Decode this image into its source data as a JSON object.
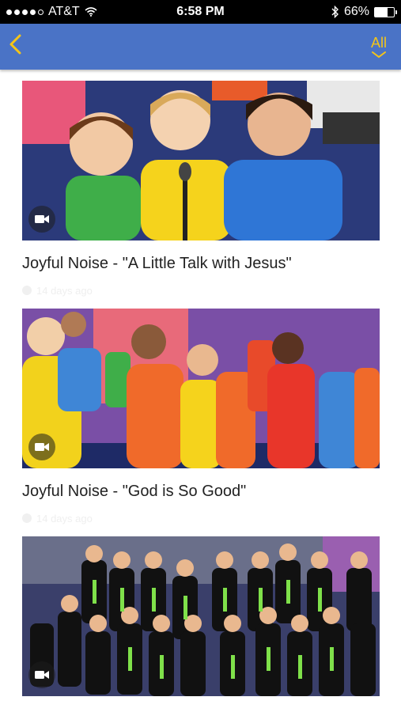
{
  "status_bar": {
    "carrier": "AT&T",
    "time": "6:58 PM",
    "battery_percent": "66%",
    "battery_level": 0.66,
    "icons": [
      "wifi-icon",
      "bluetooth-icon",
      "battery-icon"
    ]
  },
  "nav": {
    "back_icon": "chevron-left-icon",
    "filter_label": "All",
    "filter_icon": "chevron-down-icon",
    "accent_color": "#f5c518",
    "bar_color": "#4a73c6"
  },
  "videos": [
    {
      "title": "Joyful Noise - \"A Little Talk with Jesus\"",
      "age": "14 days ago"
    },
    {
      "title": "Joyful Noise - \"God is So Good\"",
      "age": "14 days ago"
    },
    {
      "title": "",
      "age": ""
    }
  ]
}
